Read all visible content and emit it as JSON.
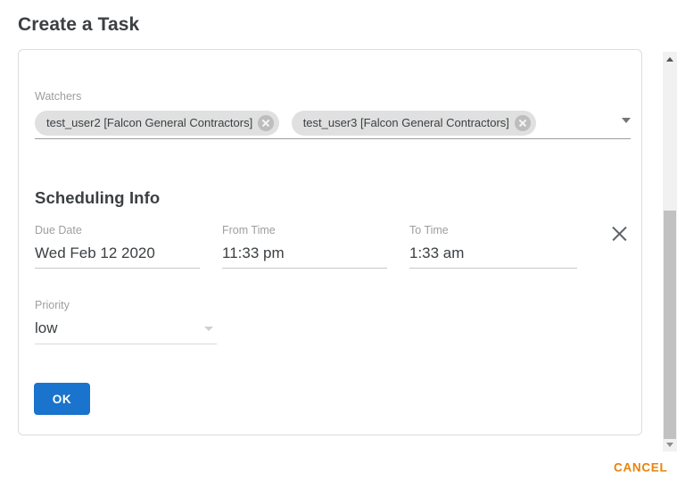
{
  "dialog": {
    "title": "Create a Task"
  },
  "watchers": {
    "label": "Watchers",
    "chips": [
      {
        "label": "test_user2 [Falcon General Contractors]",
        "remove_icon": "chip-close-icon"
      },
      {
        "label": "test_user3 [Falcon General Contractors]",
        "remove_icon": "chip-close-icon"
      }
    ],
    "dropdown_icon": "chevron-down-icon"
  },
  "scheduling": {
    "heading": "Scheduling Info",
    "fields": [
      {
        "label": "Due Date",
        "value": "Wed Feb 12 2020"
      },
      {
        "label": "From Time",
        "value": "11:33 pm"
      },
      {
        "label": "To Time",
        "value": "1:33 am"
      }
    ],
    "clear_icon": "close-icon",
    "priority": {
      "label": "Priority",
      "value": "low",
      "dropdown_icon": "chevron-down-icon"
    }
  },
  "actions": {
    "ok_label": "OK",
    "cancel_label": "CANCEL"
  },
  "scrollbar": {
    "up_icon": "arrow-up-icon",
    "down_icon": "arrow-down-icon"
  },
  "colors": {
    "primary_button": "#1a73cc",
    "cancel_text": "#e8840c",
    "chip_background": "#e0e0e0",
    "text": "#3c4043",
    "label": "#9e9e9e"
  }
}
